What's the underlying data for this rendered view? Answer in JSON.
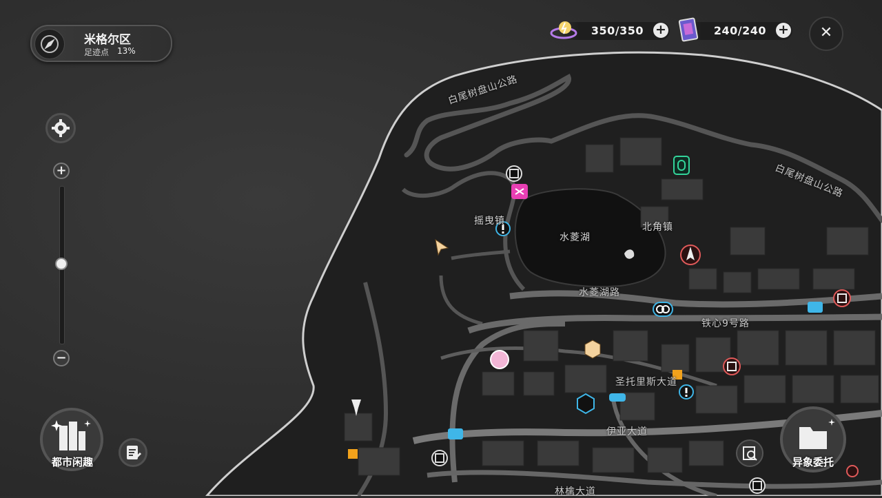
{
  "district": {
    "name": "米格尔区",
    "footprint_label": "足迹点",
    "footprint_value": "13%"
  },
  "resources": [
    {
      "icon": "battery-charge-icon",
      "value": "350/350"
    },
    {
      "icon": "film-card-icon",
      "value": "240/240"
    }
  ],
  "buttons": {
    "close": "✕",
    "zoom_in": "+",
    "zoom_out": "−",
    "plus": "+"
  },
  "zoom_level": 0.5,
  "bottom": {
    "city_fun_label": "都市闲趣",
    "commission_label": "异象委托"
  },
  "map_labels": {
    "road_north_1": "白尾树盘山公路",
    "road_north_2": "白尾树盘山公路",
    "town_west": "摇曳镇",
    "town_north": "北角镇",
    "lake": "水菱湖",
    "lake_road": "水菱湖路",
    "road_tiexin": "铁心9号路",
    "avenue_santo": "圣托里斯大道",
    "avenue_iya": "伊亚大道",
    "avenue_linqin": "林檎大道"
  },
  "colors": {
    "quest_blue": "#3fb6e8",
    "vendor_red": "#e05a5a",
    "shop_orange": "#f2a21b",
    "hollow_green": "#33d49a",
    "event_pink": "#e83fb4"
  }
}
